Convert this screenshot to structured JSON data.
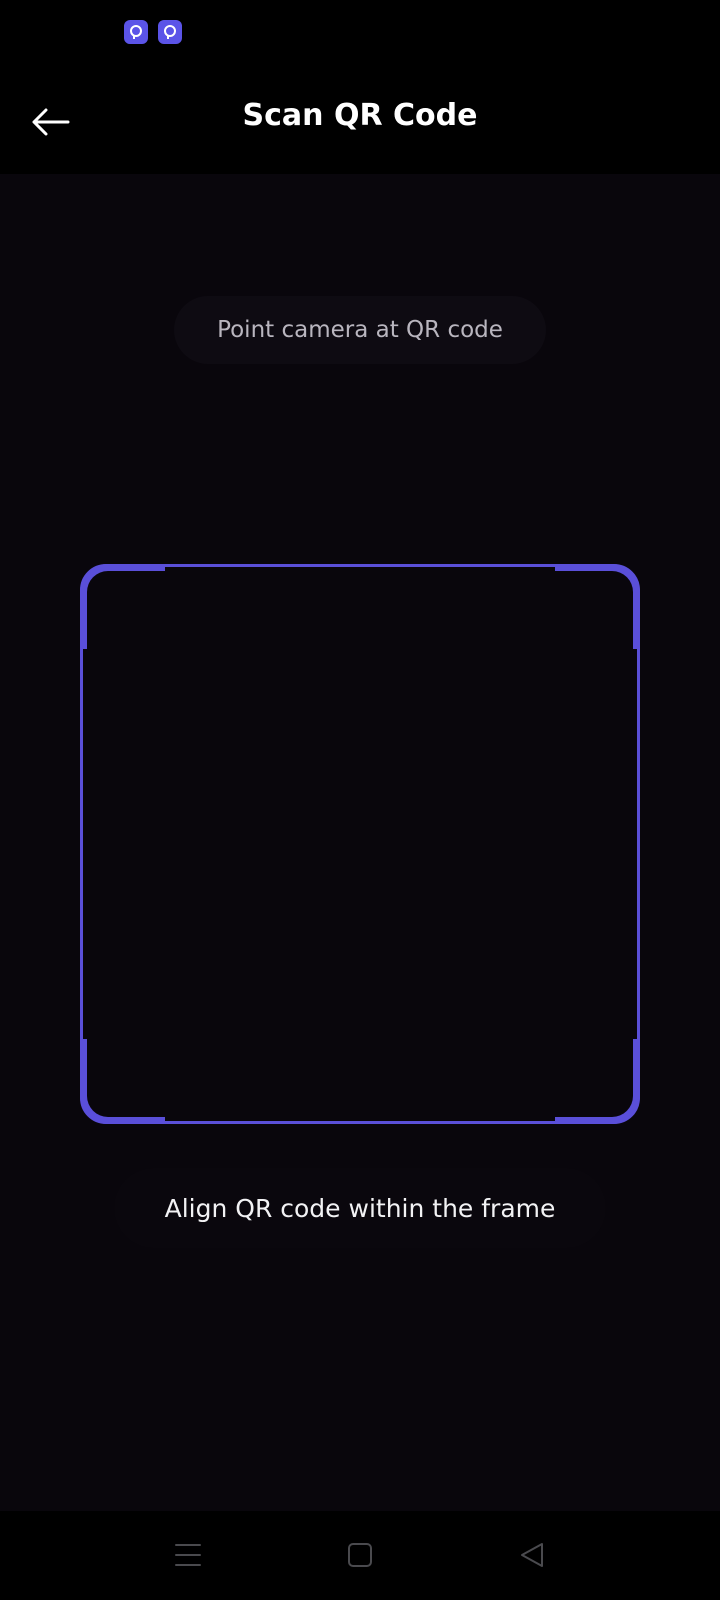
{
  "status_bar": {
    "icons": [
      "app-notification-icon",
      "app-notification-icon"
    ]
  },
  "app_bar": {
    "title": "Scan QR Code",
    "back_icon": "arrow-left-icon"
  },
  "scanner": {
    "top_hint": "Point camera at QR code",
    "instruction": "Align QR code within the frame"
  },
  "nav_bar": {
    "buttons": [
      "menu-icon",
      "home-square-icon",
      "back-triangle-icon"
    ]
  },
  "colors": {
    "accent": "#5a4fd9",
    "background": "#000000",
    "camera_background": "#09060c",
    "title_text": "#ffffff",
    "hint_text": "#b9b6bf"
  }
}
